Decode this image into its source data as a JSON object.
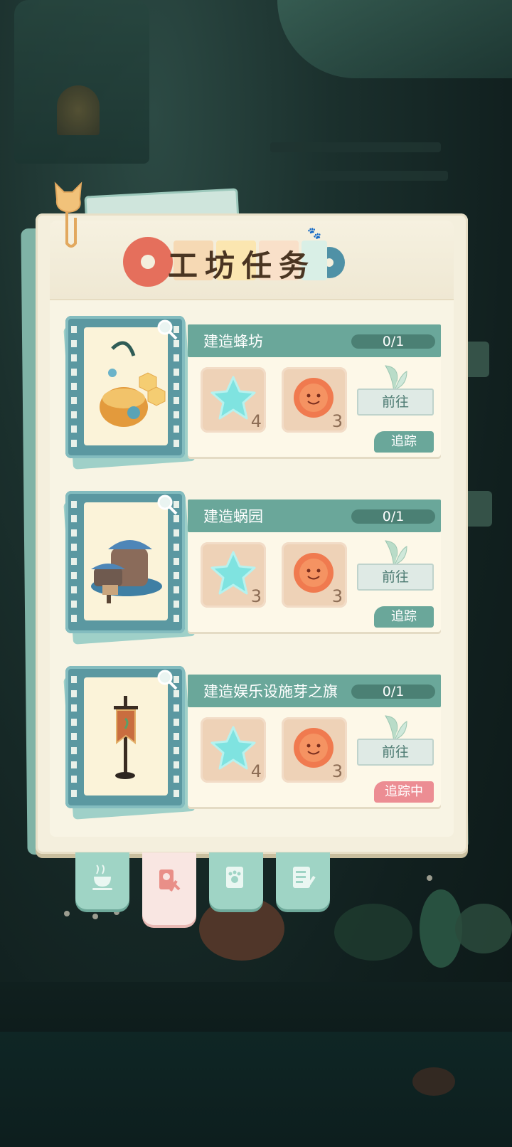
{
  "panel": {
    "title": "工坊任务"
  },
  "tasks": [
    {
      "name": "建造蜂坊",
      "progress": "0/1",
      "materials": [
        {
          "icon": "star-icon",
          "qty": "4"
        },
        {
          "icon": "sun-face-icon",
          "qty": "3"
        }
      ],
      "go_label": "前往",
      "track_label": "追踪",
      "tracking": false
    },
    {
      "name": "建造蜗园",
      "progress": "0/1",
      "materials": [
        {
          "icon": "star-icon",
          "qty": "3"
        },
        {
          "icon": "sun-face-icon",
          "qty": "3"
        }
      ],
      "go_label": "前往",
      "track_label": "追踪",
      "tracking": false
    },
    {
      "name": "建造娱乐设施芽之旗",
      "progress": "0/1",
      "materials": [
        {
          "icon": "star-icon",
          "qty": "4"
        },
        {
          "icon": "sun-face-icon",
          "qty": "3"
        }
      ],
      "go_label": "前往",
      "track_label": "追踪中",
      "tracking": true
    }
  ],
  "tabs": [
    {
      "icon": "teacup-icon",
      "selected": false
    },
    {
      "icon": "workshop-task-icon",
      "selected": true
    },
    {
      "icon": "paw-card-icon",
      "selected": false
    },
    {
      "icon": "notes-icon",
      "selected": false
    }
  ],
  "colors": {
    "accent_green": "#6aa79a",
    "tracking_pink": "#ec8d93",
    "panel_cream": "#f4efdd"
  }
}
